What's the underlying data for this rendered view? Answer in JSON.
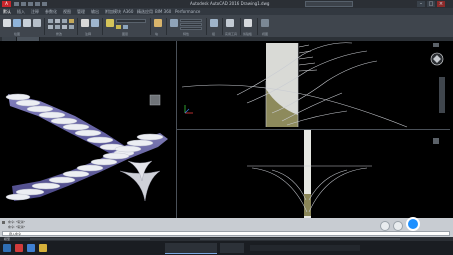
{
  "app": {
    "window_title": "Autodesk AutoCAD 2016   Drawing1.dwg",
    "menu_button_label": "A",
    "window_buttons": [
      "–",
      "□",
      "×"
    ]
  },
  "ribbon_tabs": [
    "默认",
    "插入",
    "注释",
    "参数化",
    "视图",
    "管理",
    "输出",
    "附加模块",
    "A360",
    "精选应用",
    "BIM 360",
    "Performance"
  ],
  "ribbon_panels": [
    "绘图",
    "修改",
    "注释",
    "图层",
    "块",
    "特性",
    "组",
    "实用工具",
    "剪贴板",
    "视图"
  ],
  "doc_tabs": [
    "开始",
    "Drawing1*"
  ],
  "command_line": {
    "history": [
      "命令: *取消*",
      "命令: *取消*"
    ],
    "prompt": "键入命令"
  },
  "status": {
    "coords": "",
    "model_tab": "模型"
  },
  "taskbar": {
    "time": "",
    "date": ""
  },
  "colors": {
    "ribbon_bg": "#3f454d",
    "viewport_bg": "#000000",
    "stair_tread": "#e8e8ee",
    "stair_riser": "#7b78c8",
    "accent_blue": "#1e90ff"
  }
}
